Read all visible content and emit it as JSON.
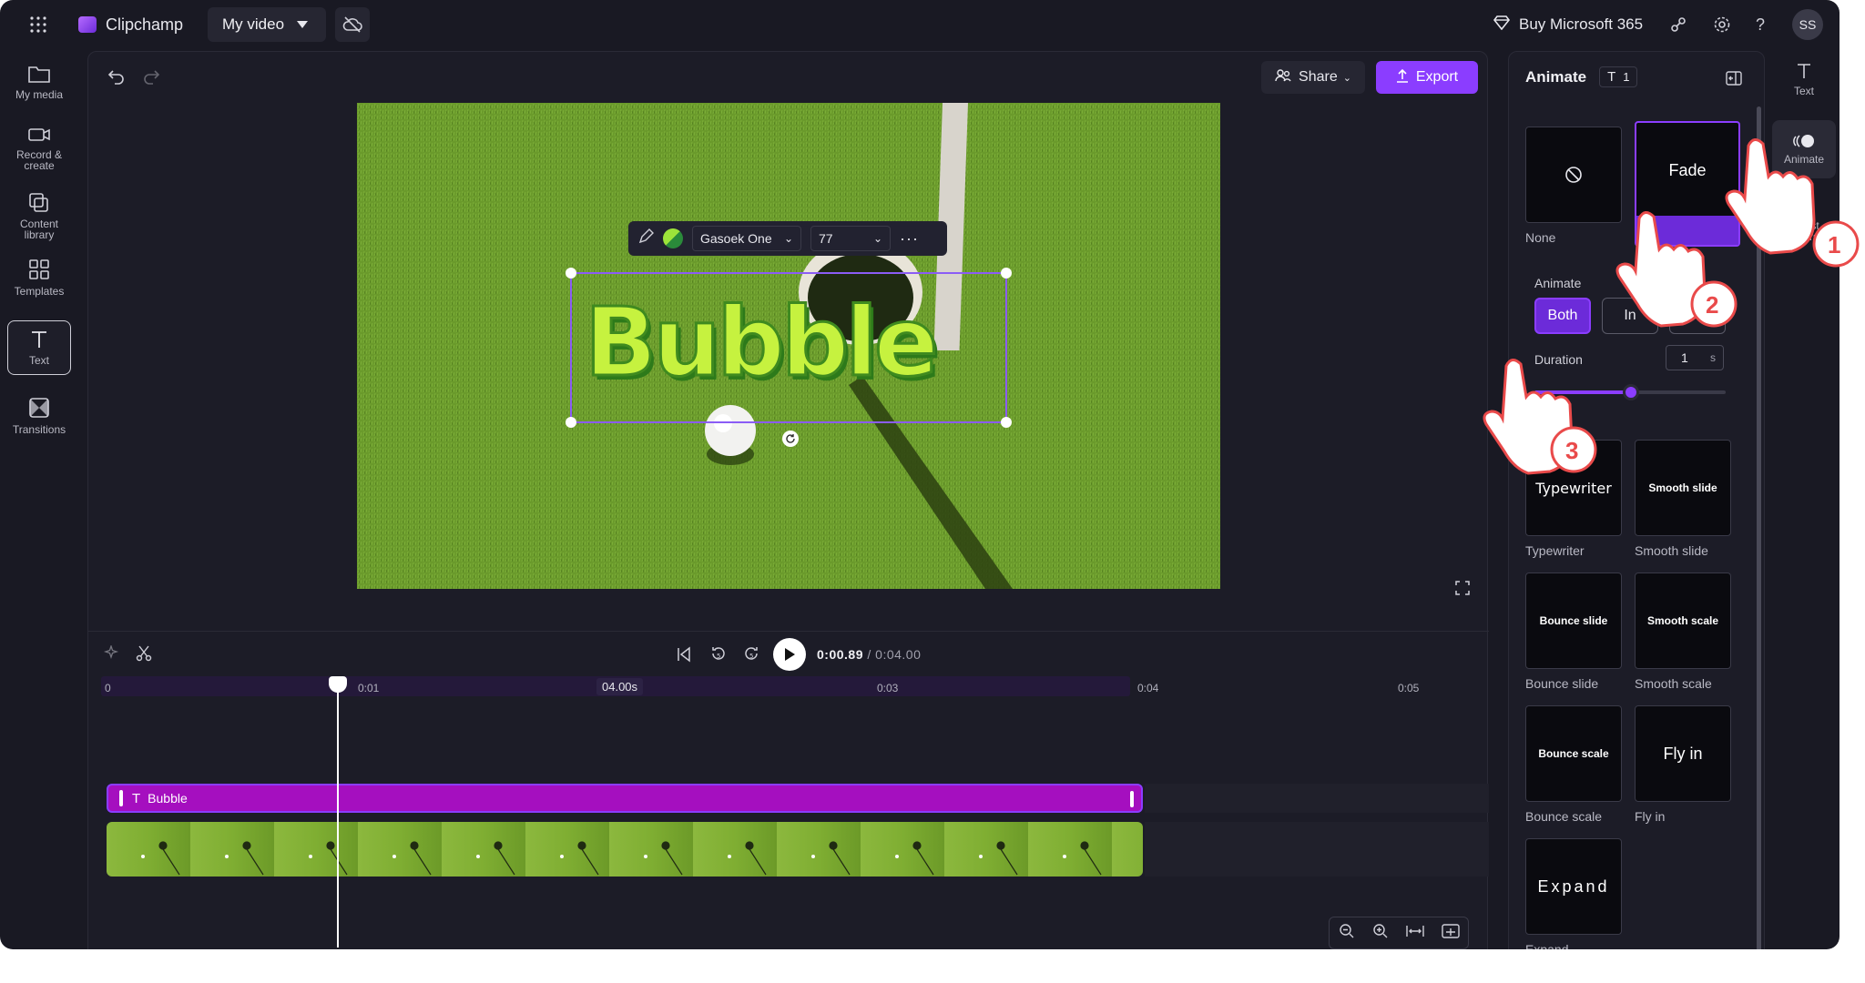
{
  "topbar": {
    "app_name": "Clipchamp",
    "project_name": "My video",
    "buy_label": "Buy Microsoft 365",
    "avatar_initials": "SS"
  },
  "left_rail": {
    "items": [
      {
        "label": "My media",
        "icon": "folder-icon"
      },
      {
        "label": "Record & create",
        "icon": "camera-icon"
      },
      {
        "label": "Content library",
        "icon": "library-icon"
      },
      {
        "label": "Templates",
        "icon": "templates-icon"
      },
      {
        "label": "Text",
        "icon": "text-icon"
      },
      {
        "label": "Transitions",
        "icon": "transitions-icon"
      }
    ]
  },
  "editor": {
    "share_label": "Share",
    "export_label": "Export",
    "text_toolbar": {
      "font": "Gasoek One",
      "size": "77"
    },
    "overlay_text": "Bubble"
  },
  "playback": {
    "current_time": "0:00.89",
    "total_time": "/ 0:04.00"
  },
  "timeline": {
    "ticks": [
      "0",
      "0:01",
      "04.00s",
      "0:03",
      "0:04",
      "0:05"
    ],
    "text_clip_label": "Bubble"
  },
  "animate_panel": {
    "title": "Animate",
    "selection_count": "1",
    "none_label": "None",
    "fade_card": "Fade",
    "fade_caption_partial": "Fa",
    "animate_label": "Animate",
    "direction_options": [
      "Both",
      "In",
      "O"
    ],
    "selected_direction": "Both",
    "duration_label": "Duration",
    "duration_value": "1",
    "duration_unit": "s",
    "duration_slider_fraction": 0.5,
    "presets": [
      {
        "card": "Typewriter",
        "caption": "Typewriter"
      },
      {
        "card": "Smooth slide",
        "caption": "Smooth slide"
      },
      {
        "card": "Bounce slide",
        "caption": "Bounce slide"
      },
      {
        "card": "Smooth scale",
        "caption": "Smooth scale"
      },
      {
        "card": "Bounce scale",
        "caption": "Bounce scale"
      },
      {
        "card": "Fly in",
        "caption": "Fly in"
      },
      {
        "card": "Expand",
        "caption": "Expand"
      }
    ]
  },
  "far_right": {
    "items": [
      {
        "label": "Text",
        "icon": "text-icon"
      },
      {
        "label": "Animate",
        "icon": "animate-icon"
      },
      {
        "label": "Adjust colors",
        "icon": "adjust-colors-icon"
      }
    ]
  },
  "callouts": [
    "1",
    "2",
    "3"
  ],
  "colors": {
    "accent": "#8b3dff",
    "clip_purple": "#a50fbf",
    "background": "#191923",
    "text_fill": "#c6f23f"
  }
}
